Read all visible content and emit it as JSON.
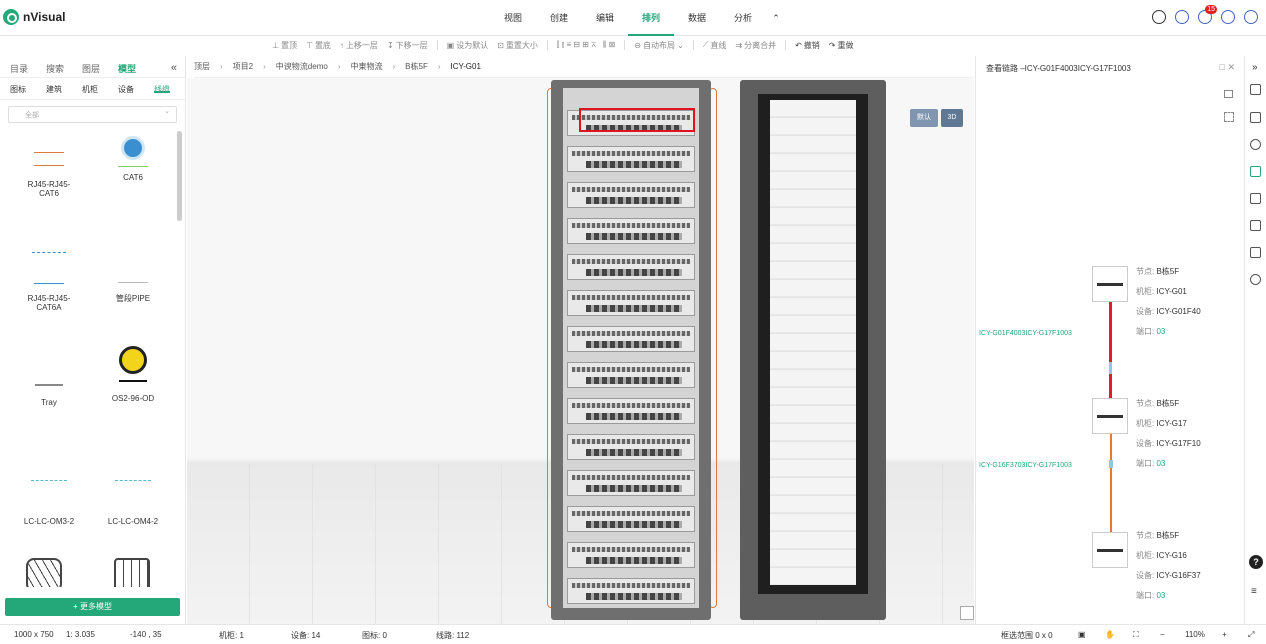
{
  "app": {
    "name": "nVisual"
  },
  "menu": [
    "视图",
    "创建",
    "编辑",
    "排列",
    "数据",
    "分析",
    "⌃"
  ],
  "menu_active": 3,
  "notifications": {
    "count": "15"
  },
  "toolbar": [
    "置顶",
    "置底",
    "上移一层",
    "下移一层",
    "设为默认",
    "重置大小",
    "自动布局",
    "直线",
    "分离合并",
    "撤销",
    "重做"
  ],
  "left_panel": {
    "tabs": [
      "目录",
      "搜索",
      "图层",
      "模型"
    ],
    "active_tab": 3,
    "subtabs": [
      "图标",
      "建筑",
      "机柜",
      "设备",
      "线缆"
    ],
    "active_subtab": 4,
    "filter_placeholder": "全部",
    "items": [
      "RJ45-RJ45-CAT6",
      "CAT6",
      "RJ45-RJ45-CAT6A",
      "管段PIPE",
      "Tray",
      "OS2-96-OD",
      "LC-LC-OM3-2",
      "LC-LC-OM4-2"
    ],
    "more_button": "+ 更多模型"
  },
  "breadcrumb": [
    "顶层",
    "项目2",
    "中谀物流demo",
    "中東物流",
    "B栋5F",
    "ICY-G01"
  ],
  "view_buttons": [
    "默认",
    "3D"
  ],
  "right_panel": {
    "title": "查看链路 –ICY-G01F4003ICY-G17F1003",
    "links": [
      "ICY-G01F4003ICY-G17F1003",
      "ICY-G16F3703ICY-G17F1003"
    ],
    "nodes": [
      {
        "node_label": "节点:",
        "node": "B栋5F",
        "cabinet_label": "机柜:",
        "cabinet": "ICY-G01",
        "device_label": "设备:",
        "device": "ICY-G01F40",
        "port_label": "端口:",
        "port": "03"
      },
      {
        "node_label": "节点:",
        "node": "B栋5F",
        "cabinet_label": "机柜:",
        "cabinet": "ICY-G17",
        "device_label": "设备:",
        "device": "ICY-G17F10",
        "port_label": "端口:",
        "port": "03"
      },
      {
        "node_label": "节点:",
        "node": "B栋5F",
        "cabinet_label": "机柜:",
        "cabinet": "ICY-G16",
        "device_label": "设备:",
        "device": "ICY-G16F37",
        "port_label": "端口:",
        "port": "03"
      }
    ],
    "colors": {
      "link_top": "#e02020",
      "link_bottom": "#e07a3a",
      "accent": "#24a779"
    }
  },
  "status": {
    "size": "1000 x 750",
    "scale": "1: 3.035",
    "coords": "-140 , 35",
    "cabinets": "机柜: 1",
    "devices": "设备: 14",
    "icons": "图标: 0",
    "lines": "线路: 112",
    "selection": "框选范围  0 x 0",
    "zoom": "110%"
  }
}
